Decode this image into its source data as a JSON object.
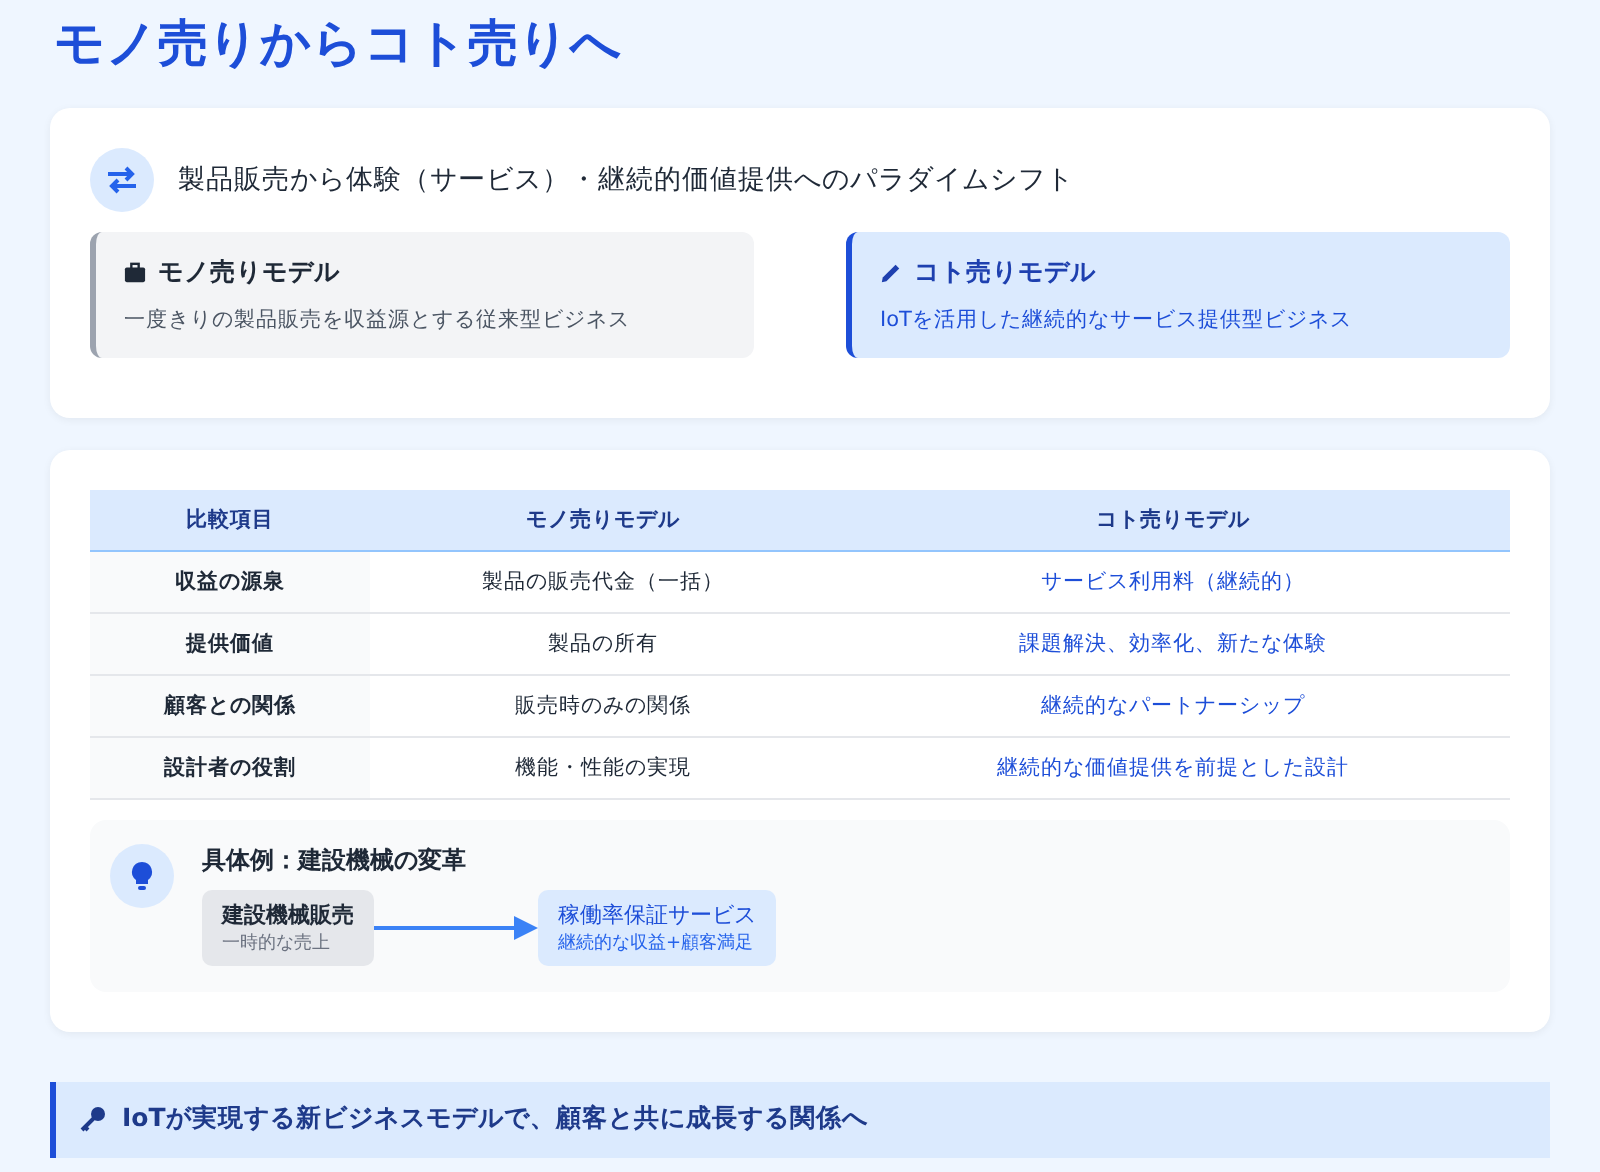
{
  "title": "モノ売りからコト売りへ",
  "overview": {
    "heading": "製品販売から体験（サービス）・継続的価値提供へのパラダイムシフト",
    "models": [
      {
        "kind": "old",
        "title": "モノ売りモデル",
        "description": "一度きりの製品販売を収益源とする従来型ビジネス"
      },
      {
        "kind": "new",
        "title": "コト売りモデル",
        "description": "IoTを活用した継続的なサービス提供型ビジネス"
      }
    ]
  },
  "table": {
    "columns": [
      "比較項目",
      "モノ売りモデル",
      "コト売りモデル"
    ],
    "rows": [
      [
        "収益の源泉",
        "製品の販売代金（一括）",
        "サービス利用料（継続的）"
      ],
      [
        "提供価値",
        "製品の所有",
        "課題解決、効率化、新たな体験"
      ],
      [
        "顧客との関係",
        "販売時のみの関係",
        "継続的なパートナーシップ"
      ],
      [
        "設計者の役割",
        "機能・性能の実現",
        "継続的な価値提供を前提とした設計"
      ]
    ]
  },
  "example": {
    "heading": "具体例：建設機械の変革",
    "from": {
      "title": "建設機械販売",
      "subtitle": "一時的な売上"
    },
    "to": {
      "title": "稼働率保証サービス",
      "subtitle": "継続的な収益+顧客満足"
    }
  },
  "banner": "IoTが実現する新ビジネスモデルで、顧客と共に成長する関係へ"
}
